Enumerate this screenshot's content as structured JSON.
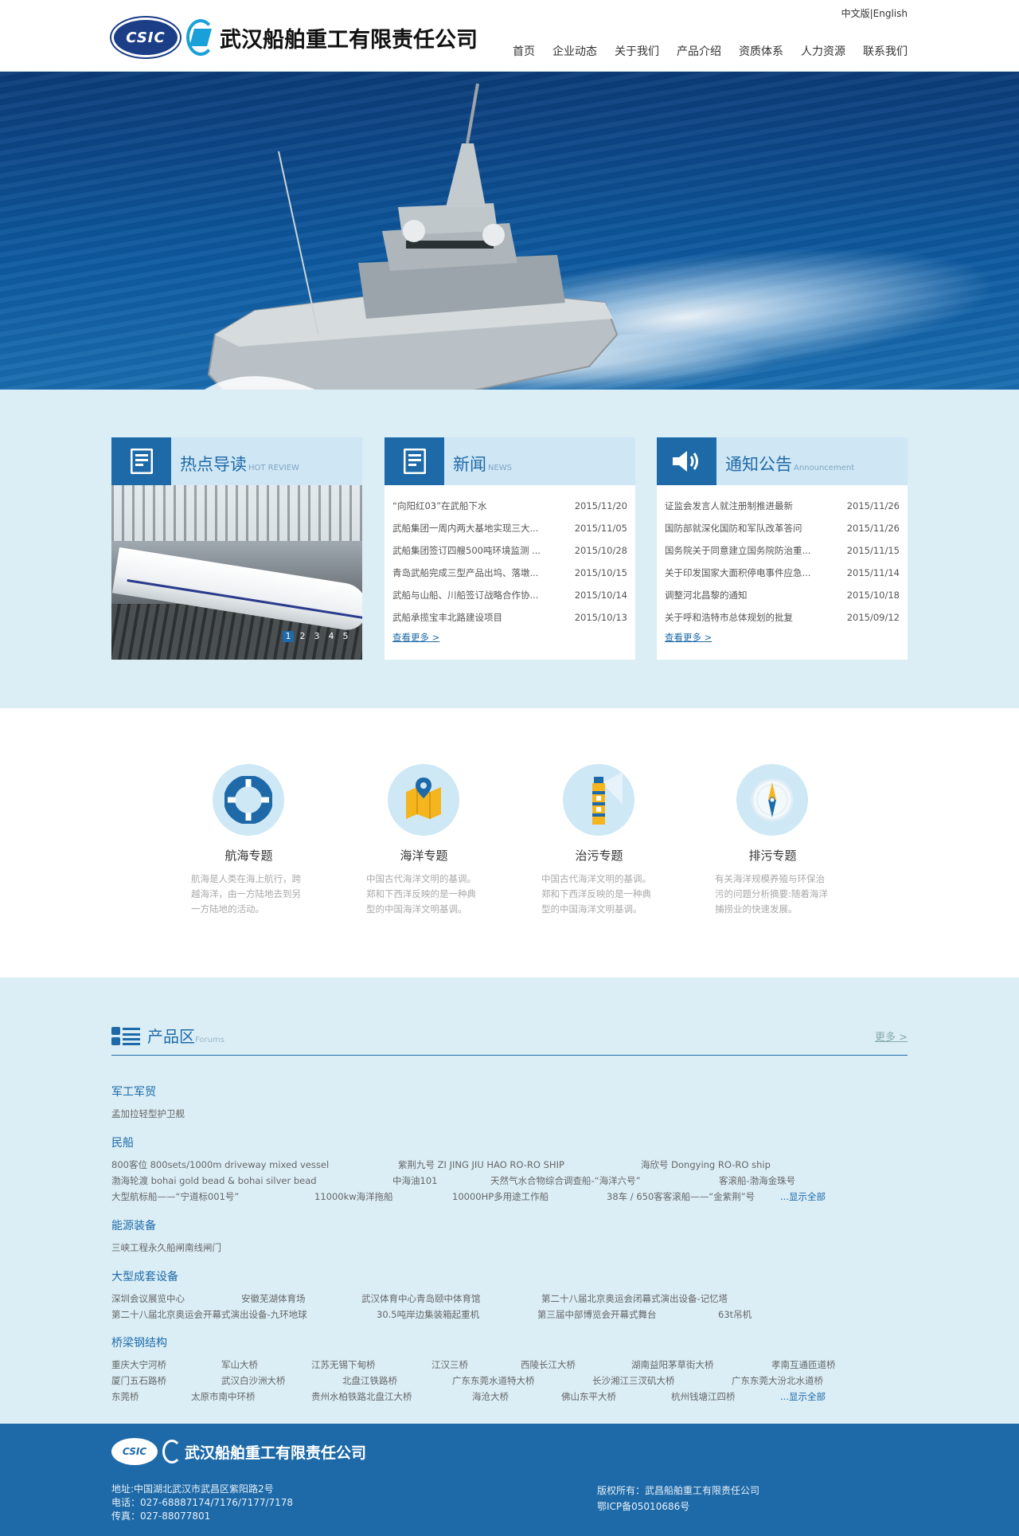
{
  "header": {
    "company_name": "武汉船舶重工有限责任公司",
    "csic_logo": "CSIC",
    "lang": "中文版|English",
    "nav": [
      "首页",
      "企业动态",
      "关于我们",
      "产品介绍",
      "资质体系",
      "人力资源",
      "联系我们"
    ]
  },
  "hot": {
    "title": "热点导读",
    "subtitle": "HOT REVIEW",
    "pager": [
      "1",
      "2",
      "3",
      "4",
      "5"
    ]
  },
  "news": {
    "title": "新闻",
    "subtitle": "NEWS",
    "items": [
      {
        "title": "“向阳红03”在武船下水",
        "date": "2015/11/20"
      },
      {
        "title": "武船集团一周内两大基地实现三大...",
        "date": "2015/11/05"
      },
      {
        "title": "武船集团签订四艘500吨环境监测 ...",
        "date": "2015/10/28"
      },
      {
        "title": "青岛武船完成三型产品出坞、落墩...",
        "date": "2015/10/15"
      },
      {
        "title": "武船与山船、川船签订战略合作协...",
        "date": "2015/10/14"
      },
      {
        "title": "武船承揽宝丰北路建设项目",
        "date": "2015/10/13"
      }
    ],
    "more": "查看更多 >"
  },
  "notice": {
    "title": "通知公告",
    "subtitle": "Announcement",
    "items": [
      {
        "title": "证监会发言人就注册制推进最新",
        "date": "2015/11/26"
      },
      {
        "title": "国防部就深化国防和军队改革答问",
        "date": "2015/11/26"
      },
      {
        "title": "国务院关于同意建立国务院防治重...",
        "date": "2015/11/15"
      },
      {
        "title": "关于印发国家大面积停电事件应急...",
        "date": "2015/11/14"
      },
      {
        "title": "调整河北昌黎的通知",
        "date": "2015/10/18"
      },
      {
        "title": "关于呼和浩特市总体规划的批复",
        "date": "2015/09/12"
      }
    ],
    "more": "查看更多 >"
  },
  "features": [
    {
      "icon": "lifebuoy-icon",
      "title": "航海专题",
      "text": "航海是人类在海上航行，跨越海洋，由一方陆地去到另一方陆地的活动。"
    },
    {
      "icon": "map-pin-icon",
      "title": "海洋专题",
      "text": "中国古代海洋文明的基调。郑和下西洋反映的是一种典型的中国海洋文明基调。"
    },
    {
      "icon": "lighthouse-icon",
      "title": "治污专题",
      "text": "中国古代海洋文明的基调。郑和下西洋反映的是一种典型的中国海洋文明基调。"
    },
    {
      "icon": "compass-icon",
      "title": "排污专题",
      "text": "有关海洋规模养殖与环保治污的问题分析摘要:随着海洋捕捞业的快速发展。"
    }
  ],
  "products": {
    "title": "产品区",
    "subtitle": "Forums",
    "more": "更多 >",
    "categories": [
      {
        "name": "军工军贸",
        "lines": [
          [
            "孟加拉轻型护卫舰"
          ]
        ]
      },
      {
        "name": "民船",
        "lines": [
          [
            "800客位 800sets/1000m driveway mixed vessel",
            "紫荆九号 ZI JING JIU HAO RO-RO SHIP",
            "海欣号 Dongying RO-RO ship"
          ],
          [
            "渤海轮渡 bohai gold bead & bohai silver bead",
            "中海油101",
            "天然气水合物综合调查船-“海洋六号”",
            "客滚船-渤海金珠号"
          ],
          [
            "大型航标船——“宁道标001号”",
            "11000kw海洋拖船",
            "10000HP多用途工作船",
            "38车 / 650客客滚船——“金紫荆”号",
            "...显示全部"
          ]
        ]
      },
      {
        "name": "能源装备",
        "lines": [
          [
            "三峡工程永久船闸南线闸门"
          ]
        ]
      },
      {
        "name": "大型成套设备",
        "lines": [
          [
            "深圳会议展览中心",
            "安徽芜湖体育场",
            "武汉体育中心青岛颐中体育馆",
            "第二十八届北京奥运会闭幕式演出设备-记忆塔"
          ],
          [
            "第二十八届北京奥运会开幕式演出设备-九环地球",
            "30.5吨岸边集装箱起重机",
            "第三届中部博览会开幕式舞台",
            "63t吊机"
          ]
        ]
      },
      {
        "name": "桥梁钢结构",
        "lines": [
          [
            "重庆大宁河桥",
            "军山大桥",
            "江苏无锡下甸桥",
            "江汉三桥",
            "西陵长江大桥",
            "湖南益阳茅草街大桥",
            "孝南互通匝道桥"
          ],
          [
            "厦门五石路桥",
            "武汉白沙洲大桥",
            "北盘江铁路桥",
            "广东东莞水道特大桥",
            "长沙湘江三汊矶大桥",
            "广东东莞大汾北水道桥"
          ],
          [
            "东莞桥",
            "太原市南中环桥",
            "贵州水柏铁路北盘江大桥",
            "海沧大桥",
            "佛山东平大桥",
            "杭州钱塘江四桥",
            "...显示全部"
          ]
        ]
      }
    ]
  },
  "footer": {
    "company_name": "武汉船舶重工有限责任公司",
    "csic_logo": "CSIC",
    "address": "地址:中国湖北武汉市武昌区紫阳路2号",
    "phone": "电话：027-68887174/7176/7177/7178",
    "fax": "传真：027-88077801",
    "copyright": "版权所有：武昌船舶重工有限责任公司",
    "icp": "鄂ICP备05010686号"
  },
  "colors": {
    "brand": "#1e6aa8",
    "light_bg": "#dbeef6"
  }
}
